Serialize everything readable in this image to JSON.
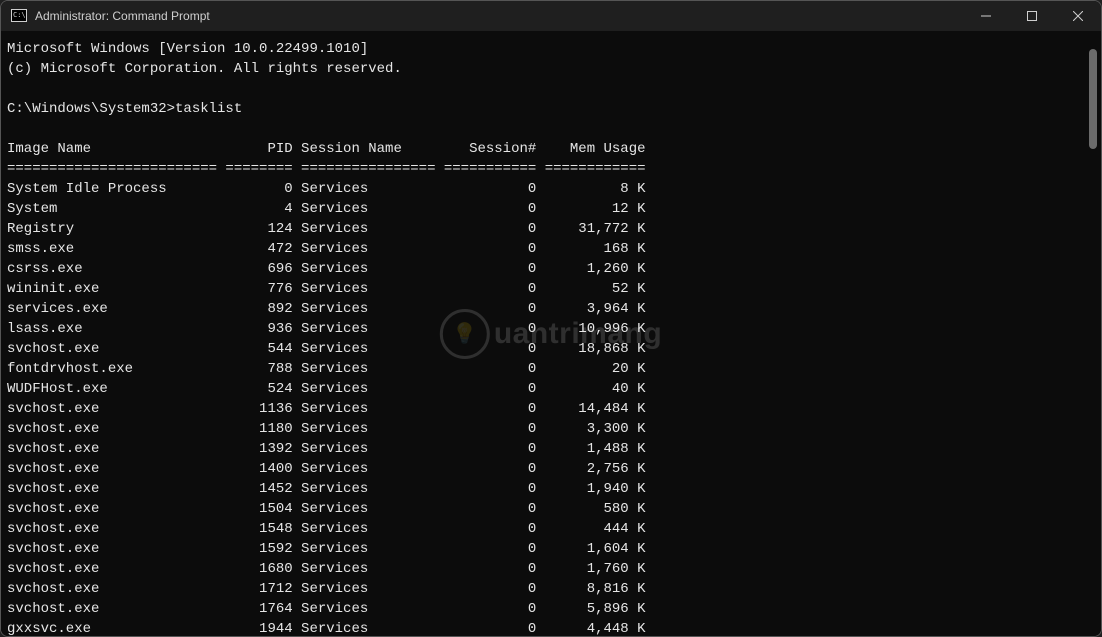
{
  "titlebar": {
    "title": "Administrator: Command Prompt"
  },
  "intro": {
    "line1": "Microsoft Windows [Version 10.0.22499.1010]",
    "line2": "(c) Microsoft Corporation. All rights reserved."
  },
  "prompt": {
    "path": "C:\\Windows\\System32>",
    "command": "tasklist"
  },
  "table": {
    "headers": {
      "image_name": "Image Name",
      "pid": "PID",
      "session_name": "Session Name",
      "session_num": "Session#",
      "mem_usage": "Mem Usage"
    },
    "sep": {
      "image_name": "=========================",
      "pid": "========",
      "session_name": "================",
      "session_num": "===========",
      "mem_usage": "============"
    },
    "rows": [
      {
        "name": "System Idle Process",
        "pid": "0",
        "sess": "Services",
        "num": "0",
        "mem": "8 K"
      },
      {
        "name": "System",
        "pid": "4",
        "sess": "Services",
        "num": "0",
        "mem": "12 K"
      },
      {
        "name": "Registry",
        "pid": "124",
        "sess": "Services",
        "num": "0",
        "mem": "31,772 K"
      },
      {
        "name": "smss.exe",
        "pid": "472",
        "sess": "Services",
        "num": "0",
        "mem": "168 K"
      },
      {
        "name": "csrss.exe",
        "pid": "696",
        "sess": "Services",
        "num": "0",
        "mem": "1,260 K"
      },
      {
        "name": "wininit.exe",
        "pid": "776",
        "sess": "Services",
        "num": "0",
        "mem": "52 K"
      },
      {
        "name": "services.exe",
        "pid": "892",
        "sess": "Services",
        "num": "0",
        "mem": "3,964 K"
      },
      {
        "name": "lsass.exe",
        "pid": "936",
        "sess": "Services",
        "num": "0",
        "mem": "10,996 K"
      },
      {
        "name": "svchost.exe",
        "pid": "544",
        "sess": "Services",
        "num": "0",
        "mem": "18,868 K"
      },
      {
        "name": "fontdrvhost.exe",
        "pid": "788",
        "sess": "Services",
        "num": "0",
        "mem": "20 K"
      },
      {
        "name": "WUDFHost.exe",
        "pid": "524",
        "sess": "Services",
        "num": "0",
        "mem": "40 K"
      },
      {
        "name": "svchost.exe",
        "pid": "1136",
        "sess": "Services",
        "num": "0",
        "mem": "14,484 K"
      },
      {
        "name": "svchost.exe",
        "pid": "1180",
        "sess": "Services",
        "num": "0",
        "mem": "3,300 K"
      },
      {
        "name": "svchost.exe",
        "pid": "1392",
        "sess": "Services",
        "num": "0",
        "mem": "1,488 K"
      },
      {
        "name": "svchost.exe",
        "pid": "1400",
        "sess": "Services",
        "num": "0",
        "mem": "2,756 K"
      },
      {
        "name": "svchost.exe",
        "pid": "1452",
        "sess": "Services",
        "num": "0",
        "mem": "1,940 K"
      },
      {
        "name": "svchost.exe",
        "pid": "1504",
        "sess": "Services",
        "num": "0",
        "mem": "580 K"
      },
      {
        "name": "svchost.exe",
        "pid": "1548",
        "sess": "Services",
        "num": "0",
        "mem": "444 K"
      },
      {
        "name": "svchost.exe",
        "pid": "1592",
        "sess": "Services",
        "num": "0",
        "mem": "1,604 K"
      },
      {
        "name": "svchost.exe",
        "pid": "1680",
        "sess": "Services",
        "num": "0",
        "mem": "1,760 K"
      },
      {
        "name": "svchost.exe",
        "pid": "1712",
        "sess": "Services",
        "num": "0",
        "mem": "8,816 K"
      },
      {
        "name": "svchost.exe",
        "pid": "1764",
        "sess": "Services",
        "num": "0",
        "mem": "5,896 K"
      },
      {
        "name": "gxxsvc.exe",
        "pid": "1944",
        "sess": "Services",
        "num": "0",
        "mem": "4,448 K"
      }
    ]
  },
  "watermark": {
    "text": "uantrimang"
  }
}
